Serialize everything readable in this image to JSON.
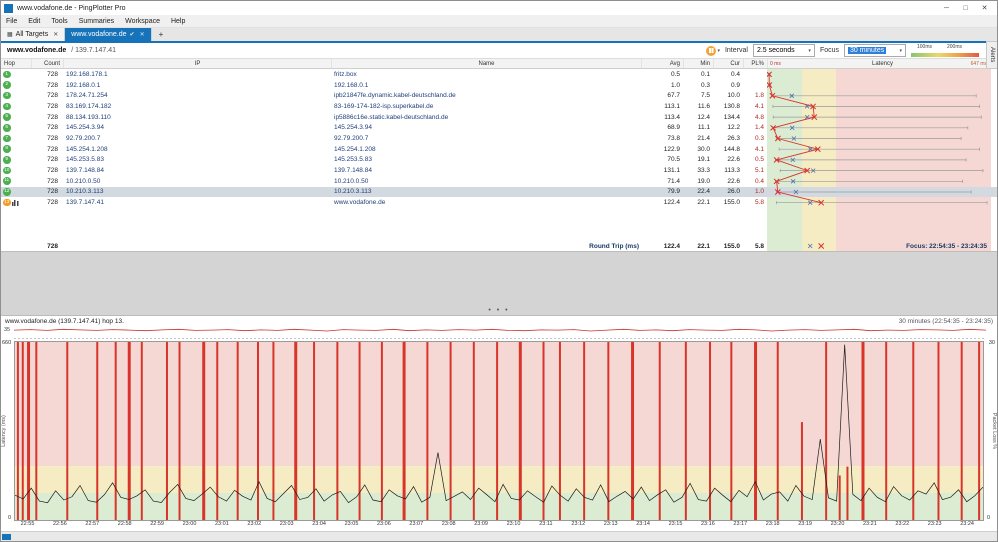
{
  "window": {
    "title": "www.vodafone.de - PingPlotter Pro",
    "minimize": "─",
    "maximize": "□",
    "close": "✕"
  },
  "menu": {
    "items": [
      "File",
      "Edit",
      "Tools",
      "Summaries",
      "Workspace",
      "Help"
    ]
  },
  "tabs": {
    "items": [
      {
        "label": "All Targets"
      },
      {
        "label": "www.vodafone.de",
        "active": true
      }
    ],
    "add": "+"
  },
  "icons": {
    "close": "✕",
    "check": "✔",
    "grid": "▦",
    "caret": "▾"
  },
  "toolbar": {
    "target": "www.vodafone.de",
    "target_ip": "/ 139.7.147.41",
    "interval_label": "Interval",
    "interval_value": "2.5 seconds",
    "focus_label": "Focus",
    "focus_value": "30 minutes",
    "legend_100": "100ms",
    "legend_200": "200ms"
  },
  "alerts_tab": "Alerts",
  "splitter": {
    "handle": "• • •"
  },
  "table": {
    "headers": {
      "hop": "Hop",
      "count": "Count",
      "ip": "IP",
      "name": "Name",
      "avg": "Avg",
      "min": "Min",
      "cur": "Cur",
      "pl": "PL%",
      "latency": "Latency",
      "scale_min": "0 ms",
      "scale_max": "647 ms"
    },
    "rows": [
      {
        "hop": "1",
        "count": "728",
        "ip": "192.168.178.1",
        "name": "fritz.box",
        "avg": "0.5",
        "min": "0.1",
        "cur": "0.4",
        "pl": ""
      },
      {
        "hop": "2",
        "count": "728",
        "ip": "192.168.0.1",
        "name": "192.168.0.1",
        "avg": "1.0",
        "min": "0.3",
        "cur": "0.9",
        "pl": ""
      },
      {
        "hop": "3",
        "count": "728",
        "ip": "178.24.71.254",
        "name": "ipb21847fe.dynamic.kabel-deutschland.de",
        "avg": "67.7",
        "min": "7.5",
        "cur": "10.0",
        "pl": "1.8"
      },
      {
        "hop": "4",
        "count": "728",
        "ip": "83.169.174.182",
        "name": "83-169-174-182-isp.superkabel.de",
        "avg": "113.1",
        "min": "11.6",
        "cur": "130.8",
        "pl": "4.1"
      },
      {
        "hop": "5",
        "count": "728",
        "ip": "88.134.193.110",
        "name": "ip5886c16e.static.kabel-deutschland.de",
        "avg": "113.4",
        "min": "12.4",
        "cur": "134.4",
        "pl": "4.8"
      },
      {
        "hop": "6",
        "count": "728",
        "ip": "145.254.3.94",
        "name": "145.254.3.94",
        "avg": "68.9",
        "min": "11.1",
        "cur": "12.2",
        "pl": "1.4"
      },
      {
        "hop": "7",
        "count": "728",
        "ip": "92.79.200.7",
        "name": "92.79.200.7",
        "avg": "73.8",
        "min": "21.4",
        "cur": "26.3",
        "pl": "0.3"
      },
      {
        "hop": "8",
        "count": "728",
        "ip": "145.254.1.208",
        "name": "145.254.1.208",
        "avg": "122.9",
        "min": "30.0",
        "cur": "144.8",
        "pl": "4.1"
      },
      {
        "hop": "9",
        "count": "728",
        "ip": "145.253.5.83",
        "name": "145.253.5.83",
        "avg": "70.5",
        "min": "19.1",
        "cur": "22.6",
        "pl": "0.5"
      },
      {
        "hop": "10",
        "count": "728",
        "ip": "139.7.148.84",
        "name": "139.7.148.84",
        "avg": "131.1",
        "min": "33.3",
        "cur": "113.3",
        "pl": "5.1"
      },
      {
        "hop": "11",
        "count": "728",
        "ip": "10.210.0.50",
        "name": "10.210.0.50",
        "avg": "71.4",
        "min": "19.0",
        "cur": "22.6",
        "pl": "0.4"
      },
      {
        "hop": "12",
        "count": "728",
        "ip": "10.210.3.113",
        "name": "10.210.3.113",
        "avg": "79.9",
        "min": "22.4",
        "cur": "26.0",
        "pl": "1.0",
        "selected": true
      },
      {
        "hop": "13",
        "count": "728",
        "ip": "139.7.147.41",
        "name": "www.vodafone.de",
        "avg": "122.4",
        "min": "22.1",
        "cur": "155.0",
        "pl": "5.8",
        "badge": "orange",
        "graphed": true
      }
    ],
    "summary": {
      "count": "728",
      "label": "Round Trip (ms)",
      "avg": "122.4",
      "min": "22.1",
      "cur": "155.0",
      "pl": "5.8",
      "focus": "Focus: 22:54:35 - 23:24:35"
    }
  },
  "graph": {
    "title_left": "www.vodafone.de (139.7.147.41) hop 13.",
    "title_right": "30 minutes (22:54:35 - 23:24:35)",
    "mini_axis": "35",
    "y_left_max": "660",
    "y_left_min": "0",
    "y_right_max": "30",
    "y_right_min": "0",
    "y_left_label": "Latency (ms)",
    "y_right_label": "Packet Loss %"
  },
  "colors": {
    "accent_blue": "#1673b9",
    "zone_green": "#dcecd2",
    "zone_yellow": "#f5ecc3",
    "zone_red": "#f5d8d3",
    "loss_bar": "#d8342a",
    "latency_line": "#1a1a1a",
    "badge_green": "#4caf50",
    "badge_orange": "#f59a23",
    "avg_marker": "#4a6fae"
  },
  "chart_data": {
    "type": "line",
    "title": "www.vodafone.de (139.7.147.41) hop 13.",
    "time_range": "30 minutes (22:54:35 - 23:24:35)",
    "ylim_latency": [
      0,
      660
    ],
    "ylim_loss": [
      0,
      30
    ],
    "zones_ms": {
      "green": [
        0,
        100
      ],
      "yellow": [
        100,
        200
      ],
      "red": [
        200,
        660
      ]
    },
    "x_ticks": [
      "22:55",
      "22:56",
      "22:57",
      "22:58",
      "22:59",
      "23:00",
      "23:01",
      "23:02",
      "23:03",
      "23:04",
      "23:05",
      "23:06",
      "23:07",
      "23:08",
      "23:09",
      "23:10",
      "23:11",
      "23:12",
      "23:13",
      "23:14",
      "23:15",
      "23:16",
      "23:17",
      "23:18",
      "23:19",
      "23:20",
      "23:21",
      "23:22",
      "23:23",
      "23:24"
    ],
    "latency_ms": [
      92,
      78,
      118,
      70,
      64,
      108,
      74,
      86,
      128,
      72,
      66,
      94,
      138,
      84,
      76,
      90,
      112,
      70,
      65,
      102,
      132,
      80,
      72,
      96,
      122,
      86,
      70,
      110,
      88,
      74,
      142,
      80,
      68,
      98,
      128,
      76,
      84,
      116,
      70,
      93,
      106,
      64,
      86,
      130,
      74,
      68,
      112,
      90,
      78,
      124,
      66,
      84,
      250,
      72,
      88,
      104,
      76,
      118,
      94,
      68,
      132,
      80,
      74,
      108,
      86,
      66,
      126,
      92,
      70,
      116,
      84,
      74,
      130,
      68,
      88,
      106,
      78,
      122,
      72,
      94,
      112,
      66,
      84,
      136,
      76,
      70,
      118,
      92,
      68,
      110,
      86,
      142,
      74,
      96,
      104,
      70,
      128,
      88,
      76,
      300,
      82,
      70,
      650,
      95,
      72,
      118,
      84,
      68,
      124,
      90,
      74,
      108,
      96,
      138,
      76,
      84,
      112,
      68,
      90,
      122
    ],
    "loss_bars": [
      [
        0.003,
        1,
        2
      ],
      [
        0.008,
        1,
        2
      ],
      [
        0.014,
        1,
        3
      ],
      [
        0.022,
        1,
        2
      ],
      [
        0.054,
        1,
        2
      ],
      [
        0.085,
        1,
        2
      ],
      [
        0.104,
        1,
        2
      ],
      [
        0.118,
        1,
        3
      ],
      [
        0.131,
        1,
        2
      ],
      [
        0.157,
        1,
        2
      ],
      [
        0.17,
        1,
        2
      ],
      [
        0.195,
        1,
        3
      ],
      [
        0.209,
        1,
        2
      ],
      [
        0.23,
        1,
        2
      ],
      [
        0.251,
        1,
        2
      ],
      [
        0.267,
        1,
        2
      ],
      [
        0.29,
        1,
        3
      ],
      [
        0.309,
        1,
        2
      ],
      [
        0.333,
        1,
        2
      ],
      [
        0.356,
        1,
        2
      ],
      [
        0.379,
        1,
        2
      ],
      [
        0.402,
        1,
        3
      ],
      [
        0.426,
        1,
        2
      ],
      [
        0.45,
        1,
        2
      ],
      [
        0.474,
        1,
        2
      ],
      [
        0.498,
        1,
        2
      ],
      [
        0.522,
        1,
        3
      ],
      [
        0.546,
        1,
        2
      ],
      [
        0.563,
        1,
        2
      ],
      [
        0.588,
        1,
        2
      ],
      [
        0.613,
        1,
        2
      ],
      [
        0.638,
        1,
        3
      ],
      [
        0.666,
        1,
        2
      ],
      [
        0.693,
        1,
        2
      ],
      [
        0.718,
        1,
        2
      ],
      [
        0.74,
        1,
        2
      ],
      [
        0.765,
        1,
        3
      ],
      [
        0.788,
        1,
        2
      ],
      [
        0.813,
        0.55,
        2
      ],
      [
        0.838,
        1,
        2
      ],
      [
        0.852,
        0.25,
        2
      ],
      [
        0.86,
        0.3,
        2
      ],
      [
        0.876,
        1,
        3
      ],
      [
        0.9,
        1,
        2
      ],
      [
        0.928,
        1,
        2
      ],
      [
        0.954,
        1,
        2
      ],
      [
        0.978,
        1,
        2
      ],
      [
        0.996,
        1,
        2
      ]
    ],
    "overview": [
      31,
      33,
      30,
      34,
      32,
      30,
      33,
      31,
      29,
      32,
      34,
      30,
      31,
      33,
      29,
      32,
      30,
      34,
      31,
      28,
      33,
      31,
      30,
      34,
      29,
      32,
      30,
      33,
      31,
      34,
      30,
      29,
      32,
      31,
      33,
      28,
      31,
      34,
      30,
      32,
      29,
      33,
      31,
      30,
      34,
      32,
      28,
      31,
      33,
      30,
      32,
      34,
      29,
      31,
      30,
      33,
      32,
      30,
      34,
      31
    ],
    "hop_bar_max_ms": [
      3,
      5,
      615,
      625,
      630,
      590,
      570,
      625,
      585,
      635,
      575,
      600,
      647
    ],
    "table_latency_scale_max_ms": 647
  }
}
